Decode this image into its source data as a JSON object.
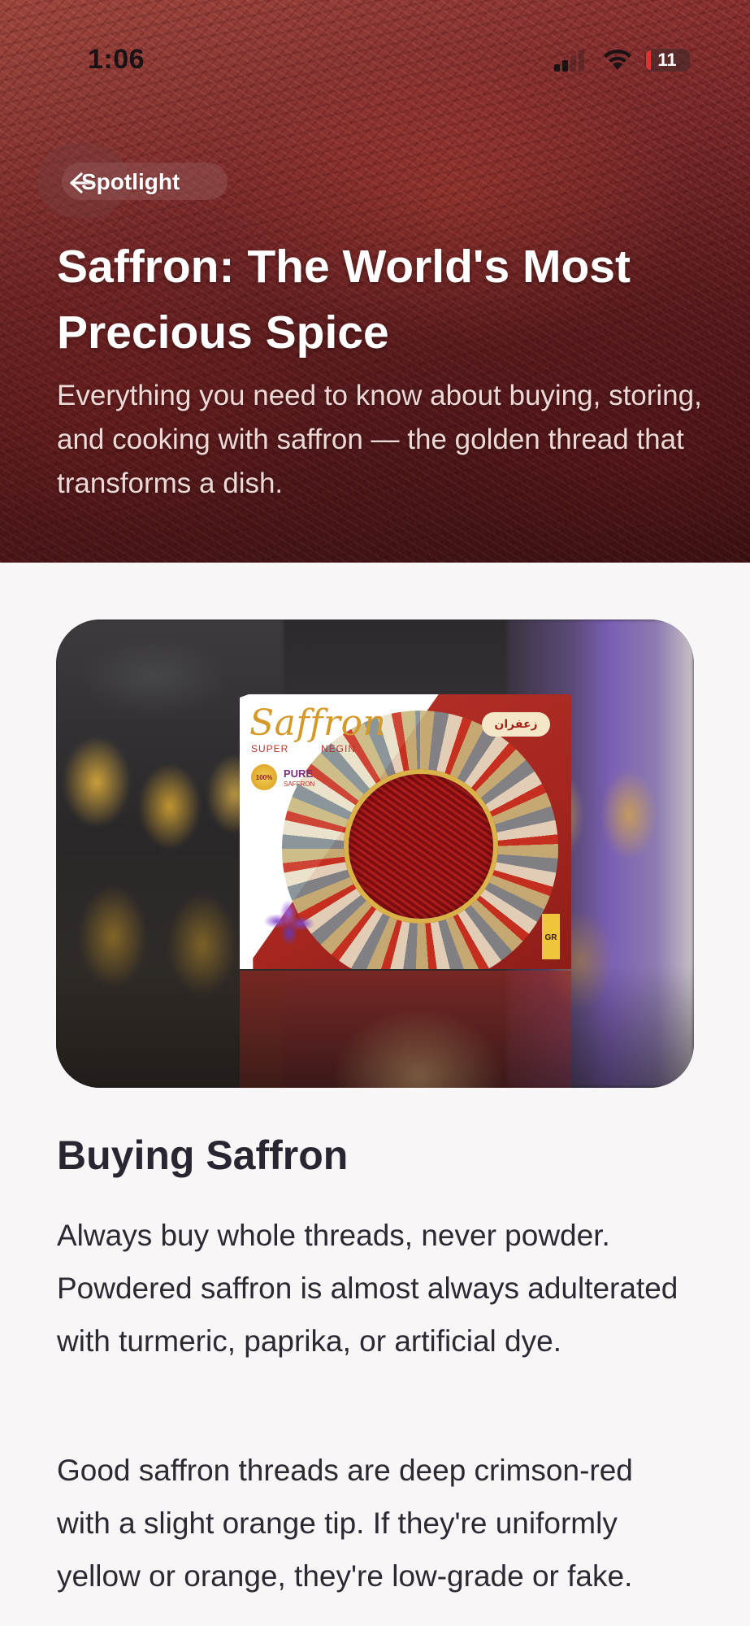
{
  "status_bar": {
    "time": "1:06",
    "battery_level": "11",
    "battery_color": "#e0322f"
  },
  "nav": {
    "back_icon": "chevron-left-icon",
    "back_label": "Spotlight"
  },
  "hero": {
    "title": "Saffron: The World's Most Precious Spice",
    "subtitle": "Everything you need to know about buying, storing, and cooking with saffron — the golden thread that transforms a dish."
  },
  "product_image": {
    "box_brand": "Saffron",
    "box_super": "SUPER",
    "box_negin": "NEGIN",
    "box_badge": "100%",
    "box_pure": "PURE",
    "box_pure_sub": "SAFFRON",
    "box_arabic": "زعفران",
    "box_weight": "GR"
  },
  "article": {
    "section_heading": "Buying Saffron",
    "paragraphs": [
      "Always buy whole threads, never powder. Powdered saffron is almost always adulterated with turmeric, paprika, or artificial dye.",
      "Good saffron threads are deep crimson-red with a slight orange tip. If they're uniformly yellow or orange, they're low-grade or fake."
    ]
  },
  "colors": {
    "background": "#f9f6f8",
    "text": "#2e2833",
    "hero_red": "#8a2f30"
  }
}
